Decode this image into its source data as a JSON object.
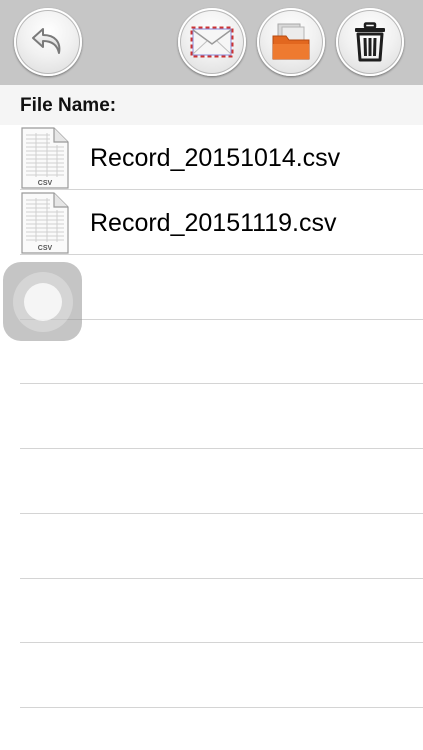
{
  "toolbar": {
    "buttons": [
      {
        "name": "back",
        "icon": "back-arrow-icon"
      },
      {
        "name": "email",
        "icon": "envelope-icon"
      },
      {
        "name": "open-in",
        "icon": "folder-icon"
      },
      {
        "name": "delete",
        "icon": "trash-icon"
      }
    ]
  },
  "header": {
    "label": "File Name:"
  },
  "files": [
    {
      "name": "Record_20151014.csv",
      "icon_label": "CSV",
      "icon": "csv-file-icon"
    },
    {
      "name": "Record_20151119.csv",
      "icon_label": "CSV",
      "icon": "csv-file-icon"
    }
  ],
  "empty_rows": 7,
  "colors": {
    "toolbar_bg": "#c6c6c6",
    "header_bg": "#f5f5f5",
    "separator": "#d4d4d4",
    "folder_orange": "#e2671f"
  }
}
